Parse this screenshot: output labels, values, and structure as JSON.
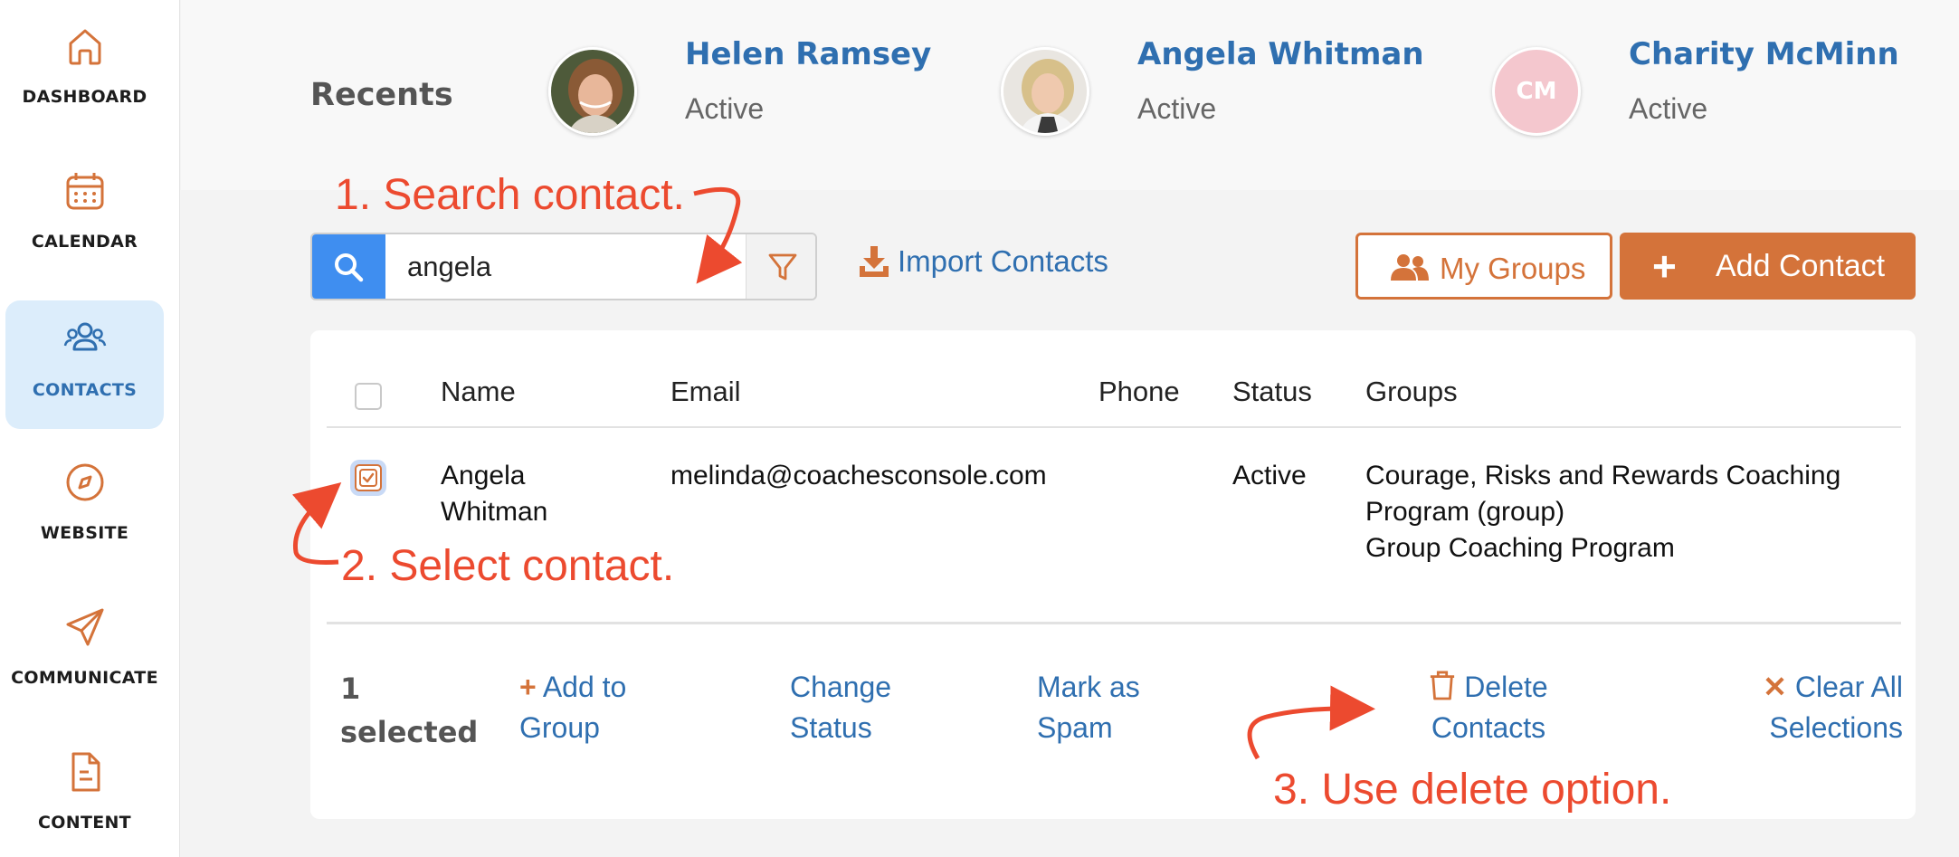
{
  "sidebar": {
    "items": [
      {
        "label": "DASHBOARD",
        "icon": "home-icon"
      },
      {
        "label": "CALENDAR",
        "icon": "calendar-icon"
      },
      {
        "label": "CONTACTS",
        "icon": "contacts-icon",
        "active": true
      },
      {
        "label": "WEBSITE",
        "icon": "compass-icon"
      },
      {
        "label": "COMMUNICATE",
        "icon": "send-icon"
      },
      {
        "label": "CONTENT",
        "icon": "document-icon"
      }
    ]
  },
  "recents": {
    "title": "Recents",
    "people": [
      {
        "name": "Helen Ramsey",
        "status": "Active",
        "avatar": "photo"
      },
      {
        "name": "Angela Whitman",
        "status": "Active",
        "avatar": "photo"
      },
      {
        "name": "Charity McMinn",
        "status": "Active",
        "initials": "CM"
      }
    ]
  },
  "toolbar": {
    "search_value": "angela",
    "import_label": "Import Contacts",
    "groups_label": "My Groups",
    "add_label": "Add Contact"
  },
  "table": {
    "columns": [
      "Name",
      "Email",
      "Phone",
      "Status",
      "Groups"
    ],
    "rows": [
      {
        "name_line1": "Angela",
        "name_line2": "Whitman",
        "email": "melinda@coachesconsole.com",
        "phone": "",
        "status": "Active",
        "groups_line1": "Courage, Risks and Rewards Coaching",
        "groups_line2": "Program (group)",
        "groups_line3": "Group Coaching Program",
        "selected": true
      }
    ]
  },
  "bulk_actions": {
    "count_line1": "1",
    "count_line2": "selected",
    "add_to_group_line1": "Add to",
    "add_to_group_line2": "Group",
    "change_status_line1": "Change",
    "change_status_line2": "Status",
    "mark_spam_line1": "Mark as",
    "mark_spam_line2": "Spam",
    "delete_line1": "Delete",
    "delete_line2": "Contacts",
    "clear_line1": "Clear All",
    "clear_line2": "Selections"
  },
  "annotations": {
    "step1": "1. Search contact.",
    "step2": "2. Select contact.",
    "step3": "3. Use delete option."
  },
  "colors": {
    "accent_orange": "#d4733a",
    "link_blue": "#2f6fb0",
    "search_blue": "#3f8ef0",
    "annotation_red": "#ec4a2f",
    "active_nav_bg": "#dcedfb"
  }
}
